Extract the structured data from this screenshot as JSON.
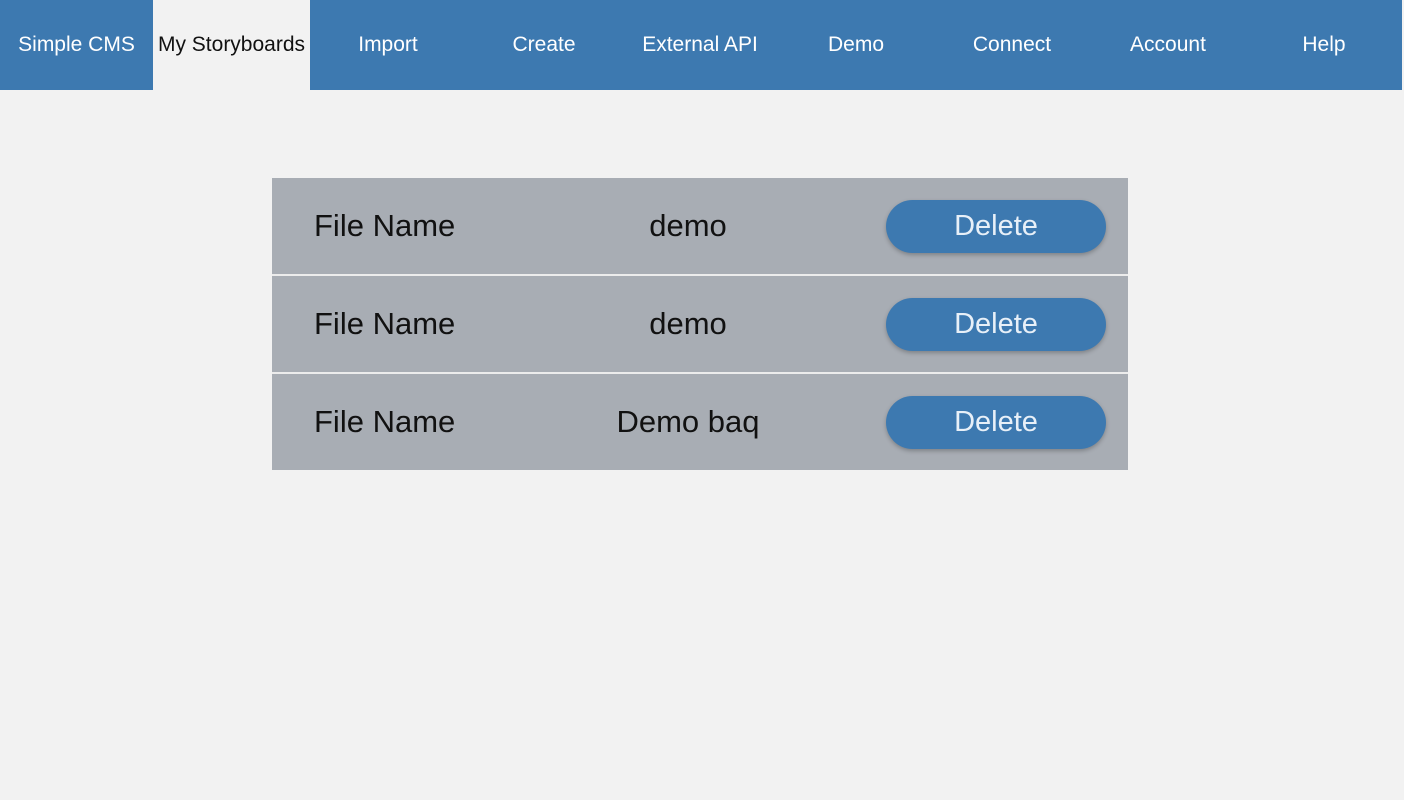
{
  "nav": {
    "items": [
      {
        "label": "Simple CMS"
      },
      {
        "label": "My Storyboards"
      },
      {
        "label": "Import"
      },
      {
        "label": "Create"
      },
      {
        "label": "External API"
      },
      {
        "label": "Demo"
      },
      {
        "label": "Connect"
      },
      {
        "label": "Account"
      },
      {
        "label": "Help"
      }
    ],
    "active": "My Storyboards"
  },
  "files": {
    "rows": [
      {
        "label": "File Name",
        "value": "demo",
        "action": "Delete"
      },
      {
        "label": "File Name",
        "value": "demo",
        "action": "Delete"
      },
      {
        "label": "File Name",
        "value": "Demo baq",
        "action": "Delete"
      }
    ]
  },
  "colors": {
    "primary": "#3d79b0",
    "background": "#f2f2f2",
    "row_background": "#a8adb4"
  }
}
